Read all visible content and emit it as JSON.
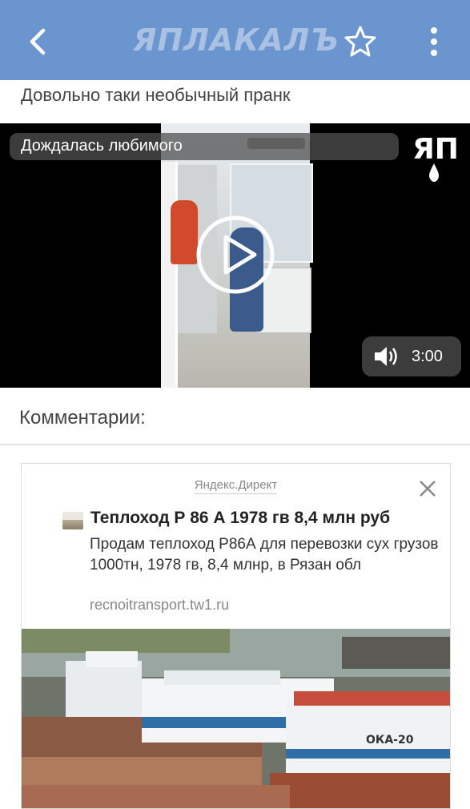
{
  "header": {
    "logo_text": "ЯПЛАКАЛЪ",
    "back_icon": "chevron-left-icon",
    "favorite_icon": "star-outline-icon",
    "menu_icon": "vertical-dots-icon",
    "background_color": "#6b95cf"
  },
  "post": {
    "title": "Довольно таки необычный пранк"
  },
  "video": {
    "title": "Дождалась любимого",
    "watermark": "ЯП",
    "duration": "3:00",
    "play_icon": "play-icon",
    "sound_icon": "speaker-icon"
  },
  "comments": {
    "heading": "Комментарии:"
  },
  "ad": {
    "source": "Яндекс.Директ",
    "title": "Теплоход Р 86 А 1978 гв 8,4 млн руб",
    "text": "Продам теплоход Р86А для перевозки сух грузов 1000тн, 1978 гв, 8,4 млнр, в Рязан обл",
    "url": "recnoitransport.tw1.ru",
    "close_icon": "close-icon",
    "ship_label": "ОКА-20"
  }
}
